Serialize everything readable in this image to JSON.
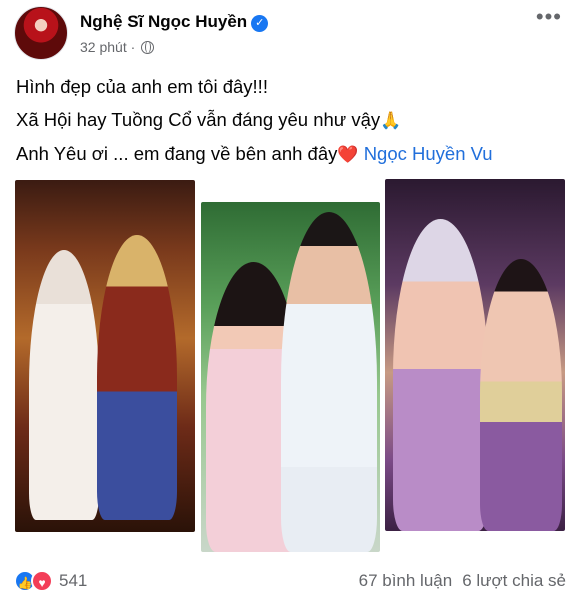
{
  "post": {
    "author": "Nghệ Sĩ Ngọc Huyền",
    "time": "32 phút",
    "separator": "·",
    "lines": [
      "Hình đẹp của anh em tôi đây!!!",
      "Xã Hội hay Tuồng Cổ vẫn đáng yêu như vậy",
      "Anh Yêu ơi ... em đang về bên anh đây"
    ],
    "tag": "Ngọc Huyền Vu",
    "emoji_pray": "🙏",
    "emoji_heart": "❤️"
  },
  "reactions": {
    "count": "541",
    "comments": "67 bình luận",
    "shares": "6 lượt chia sẻ"
  },
  "icons": {
    "verified": "verified-badge-icon",
    "privacy": "globe-icon",
    "more": "more-options-icon",
    "like": "like-reaction-icon",
    "love": "love-reaction-icon"
  },
  "colors": {
    "link": "#216fdb",
    "verified": "#1877f2",
    "love": "#f33e58",
    "muted": "#65676b"
  }
}
